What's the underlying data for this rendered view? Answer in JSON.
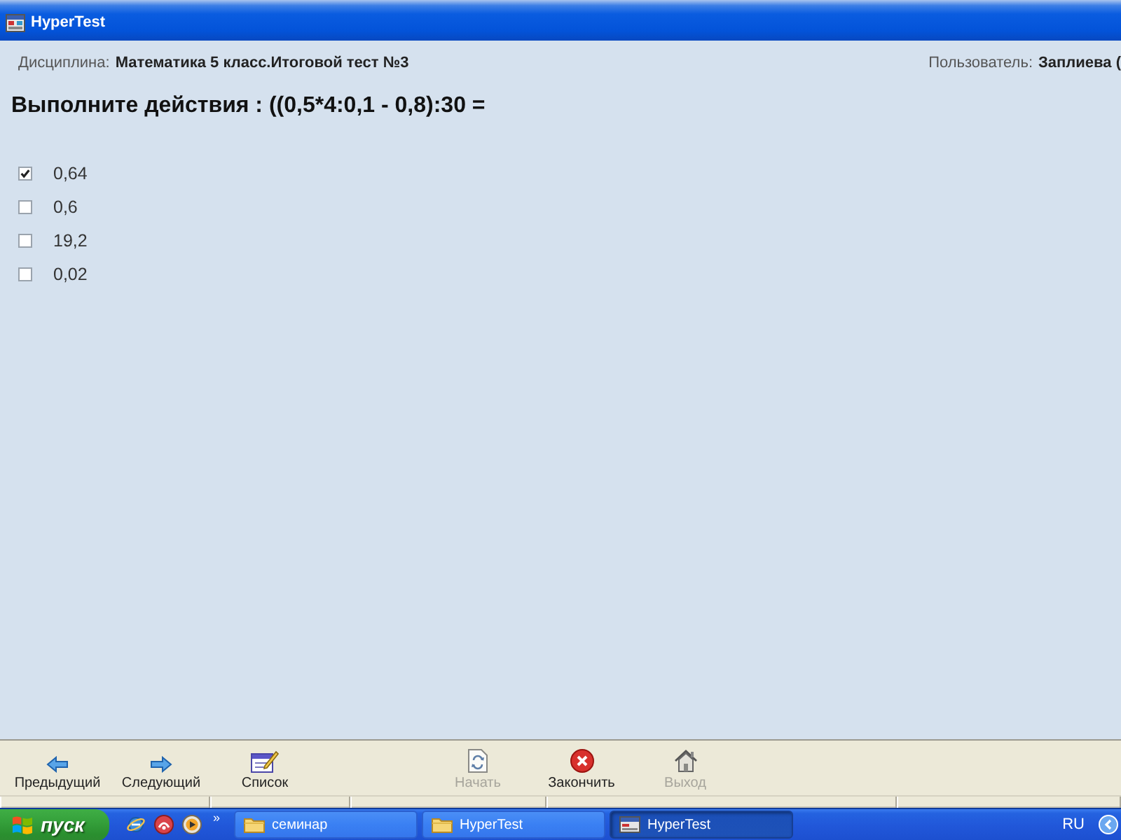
{
  "window": {
    "title": "HyperTest"
  },
  "header": {
    "discipline_label": "Дисциплина:",
    "discipline": "Математика 5 класс.Итоговой тест №3",
    "user_label": "Пользователь:",
    "user": "Заплиева ("
  },
  "question": {
    "text": "Выполните действия : ((0,5*4:0,1 - 0,8):30 ="
  },
  "answers": [
    {
      "label": "0,64",
      "checked": true
    },
    {
      "label": "0,6",
      "checked": false
    },
    {
      "label": "19,2",
      "checked": false
    },
    {
      "label": "0,02",
      "checked": false
    }
  ],
  "toolbar": [
    {
      "label": "Предыдущий",
      "disabled": false
    },
    {
      "label": "Следующий",
      "disabled": false
    },
    {
      "label": "Список",
      "disabled": false
    },
    {
      "label": "Начать",
      "disabled": true
    },
    {
      "label": "Закончить",
      "disabled": false
    },
    {
      "label": "Выход",
      "disabled": true
    }
  ],
  "taskbar": {
    "start": "пуск",
    "more": "»",
    "tasks": [
      {
        "label": "семинар",
        "selected": false
      },
      {
        "label": "HyperTest",
        "selected": false
      },
      {
        "label": "HyperTest",
        "selected": true
      }
    ],
    "language": "RU"
  }
}
